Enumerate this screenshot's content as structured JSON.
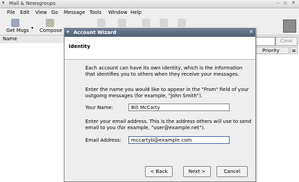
{
  "window": {
    "title": "Mail & Newsgroups",
    "controls": [
      "–",
      "▫",
      "✕"
    ]
  },
  "menubar": [
    "File",
    "Edit",
    "View",
    "Go",
    "Message",
    "Tools",
    "Window",
    "Help"
  ],
  "toolbar": {
    "get_msgs": "Get Msgs",
    "compose": "Compose"
  },
  "columns": {
    "name": "Name",
    "priority": "Priority"
  },
  "search": {
    "clear": "Clear"
  },
  "dialog": {
    "title": "Account Wizard",
    "header": "Identity",
    "intro": "Each account can have its own identity, which is the information that identifies you to others when they receive your messages.",
    "name_prompt": "Enter the name you would like to appear in the \"From\" field of your outgoing messages (for example, \"John Smith\").",
    "name_label": "Your Name:",
    "name_value": "Bill McCarty",
    "email_prompt": "Enter your email address. This is the address others will use to send email to you (for example, \"user@example.net\").",
    "email_label": "Email Address:",
    "email_value": "mccartyb@example.com",
    "back": "< Back",
    "next": "Next >",
    "cancel": "Cancel"
  }
}
